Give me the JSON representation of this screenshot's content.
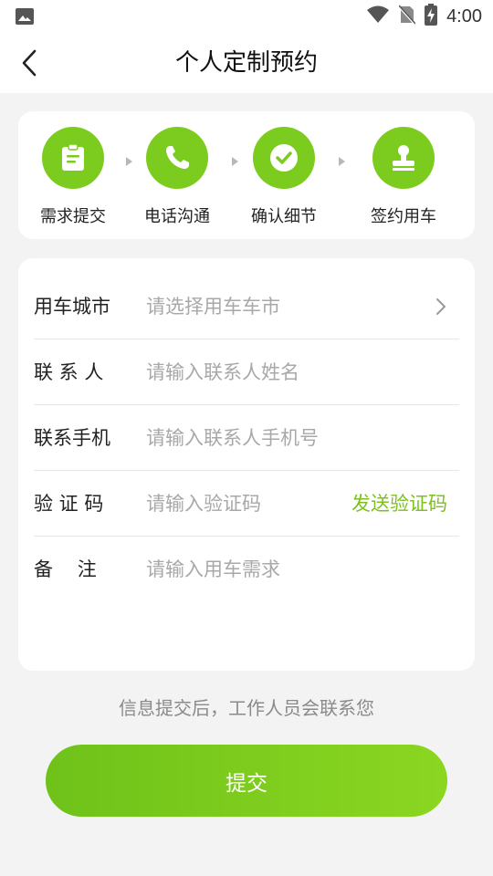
{
  "status_bar": {
    "time": "4:00",
    "icons": [
      "photo-icon",
      "wifi-icon",
      "no-sim-icon",
      "battery-charging-icon"
    ]
  },
  "header": {
    "title": "个人定制预约",
    "back_icon": "back-arrow-icon"
  },
  "steps": [
    {
      "label": "需求提交",
      "icon": "clipboard-icon"
    },
    {
      "label": "电话沟通",
      "icon": "phone-icon"
    },
    {
      "label": "确认细节",
      "icon": "check-circle-icon"
    },
    {
      "label": "签约用车",
      "icon": "stamp-icon"
    }
  ],
  "form": {
    "city": {
      "label": "用车城市",
      "placeholder": "请选择用车车市",
      "value": ""
    },
    "contact": {
      "label": "联 系 人",
      "placeholder": "请输入联系人姓名",
      "value": ""
    },
    "phone": {
      "label": "联系手机",
      "placeholder": "请输入联系人手机号",
      "value": ""
    },
    "code": {
      "label": "验 证 码",
      "placeholder": "请输入验证码",
      "value": "",
      "send_label": "发送验证码"
    },
    "remark": {
      "label": "备    注",
      "placeholder": "请输入用车需求",
      "value": ""
    }
  },
  "note": "信息提交后，工作人员会联系您",
  "submit_label": "提交",
  "colors": {
    "accent": "#7ccb1f",
    "background": "#f3f3f3",
    "card": "#ffffff"
  }
}
